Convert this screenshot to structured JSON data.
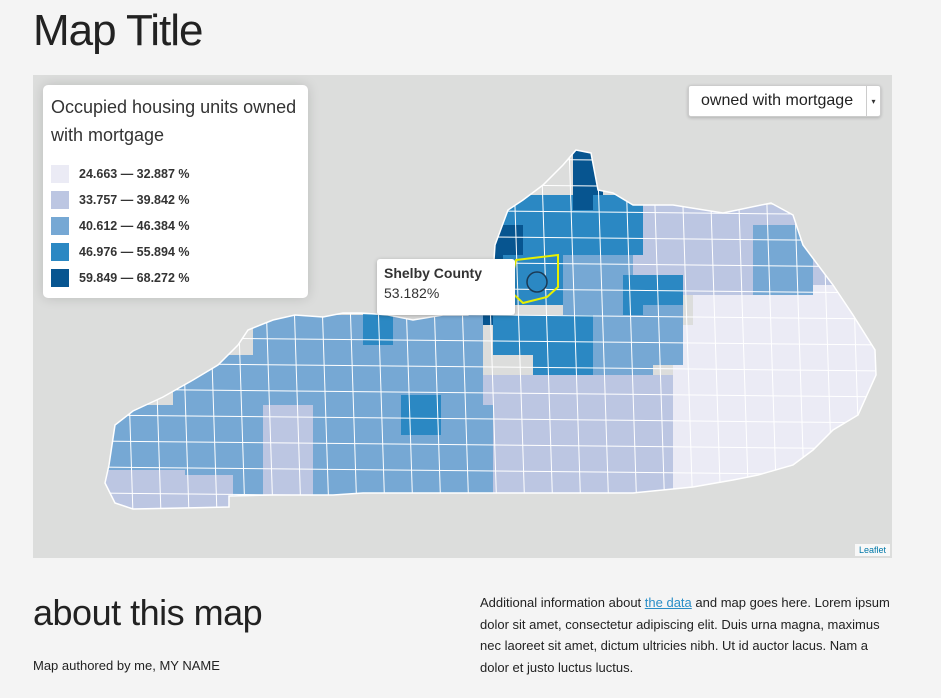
{
  "page": {
    "title": "Map Title",
    "about_title": "about this map",
    "author": "Map authored by me, MY NAME",
    "info": {
      "before": "Additional information about ",
      "link": "the data",
      "after": " and map goes here. Lorem ipsum dolor sit amet, consectetur adipiscing elit. Duis urna magna, maximus nec laoreet sit amet, dictum ultricies nibh. Ut id auctor lacus. Nam a dolor et justo luctus luctus."
    }
  },
  "legend": {
    "title": "Occupied housing units owned with mortgage",
    "classes": [
      {
        "label": "24.663 — 32.887 %",
        "color": "#ebebf5"
      },
      {
        "label": "33.757 — 39.842 %",
        "color": "#bcc6e2"
      },
      {
        "label": "40.612 — 46.384 %",
        "color": "#76a8d4"
      },
      {
        "label": "46.976 — 55.894 %",
        "color": "#2b88c3"
      },
      {
        "label": "59.849 — 68.272 %",
        "color": "#075590"
      }
    ]
  },
  "selector": {
    "value": "owned with mortgage",
    "arrow_icon": "caret-down-icon"
  },
  "tooltip": {
    "name": "Shelby County",
    "value": "53.182%"
  },
  "attribution": "Leaflet",
  "colors": {
    "map_background": "#dcdddc",
    "county_border": "#ffffff",
    "highlight_border": "#e8f000",
    "link": "#2a8ec7"
  }
}
